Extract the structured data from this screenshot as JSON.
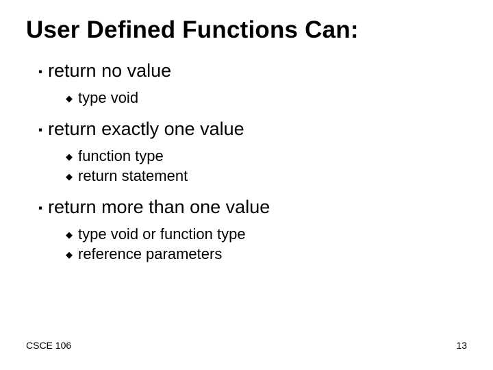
{
  "title": "User Defined Functions Can:",
  "sections": [
    {
      "label": "return no value",
      "items": [
        "type void"
      ]
    },
    {
      "label": "return exactly one value",
      "items": [
        "function type",
        "return statement"
      ]
    },
    {
      "label": "return more than one value",
      "items": [
        "type void or function type",
        "reference parameters"
      ]
    }
  ],
  "footer": {
    "left": "CSCE 106",
    "right": "13"
  }
}
